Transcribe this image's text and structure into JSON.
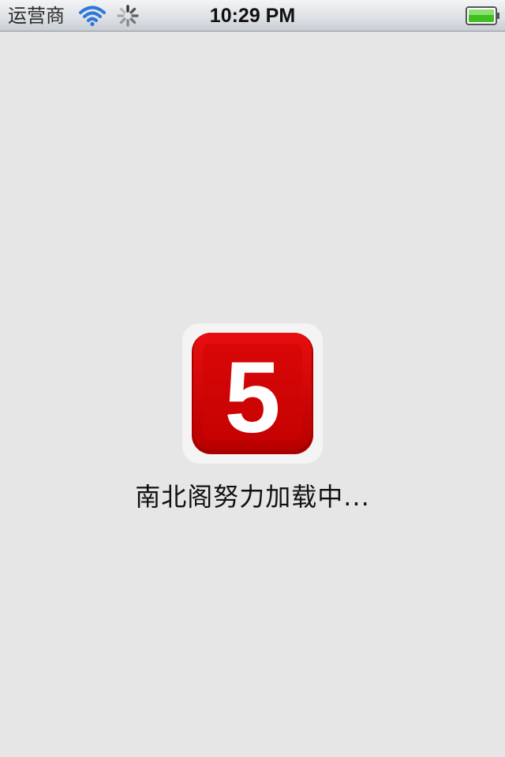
{
  "status_bar": {
    "carrier": "运营商",
    "time": "10:29 PM",
    "icons": [
      "wifi-icon",
      "activity-spinner-icon",
      "battery-icon"
    ],
    "battery_color": "#3fbf1f"
  },
  "splash": {
    "logo_digit": "5",
    "logo_color": "#d40000",
    "loading_text": "南北阁努力加载中..."
  }
}
